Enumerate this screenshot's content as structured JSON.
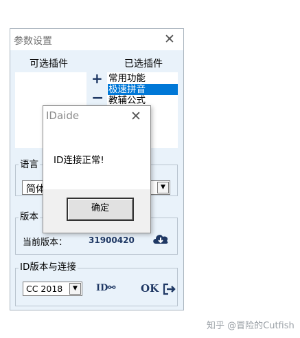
{
  "window": {
    "title": "参数设置",
    "close_glyph": "✕",
    "available_header": "可选插件",
    "selected_header": "已选插件",
    "add_glyph": "+",
    "remove_glyph": "−",
    "selected_plugins": [
      {
        "label": "常用功能",
        "active": false
      },
      {
        "label": "极速拼音",
        "active": true
      },
      {
        "label": "教辅公式",
        "active": false
      }
    ],
    "language_group": "语言",
    "language_value": "简体",
    "version_group": "版本",
    "version_label": "当前版本：",
    "version_value": "31900420",
    "id_group": "ID版本与连接",
    "cc_value": "CC 2018",
    "id_link": "ID⚯",
    "ok_label": "OK",
    "icons": {
      "download": "cloud-download-icon",
      "exit": "exit-icon",
      "link": "link-icon"
    },
    "colors": {
      "panel_bg": "#e9f2fa",
      "selection": "#0078d7",
      "accent": "#1f3864"
    }
  },
  "dialog": {
    "title": "IDaide",
    "close_glyph": "✕",
    "message": "ID连接正常!",
    "ok_label": "确定"
  },
  "watermark": "知乎 @冒险的Cutfish"
}
